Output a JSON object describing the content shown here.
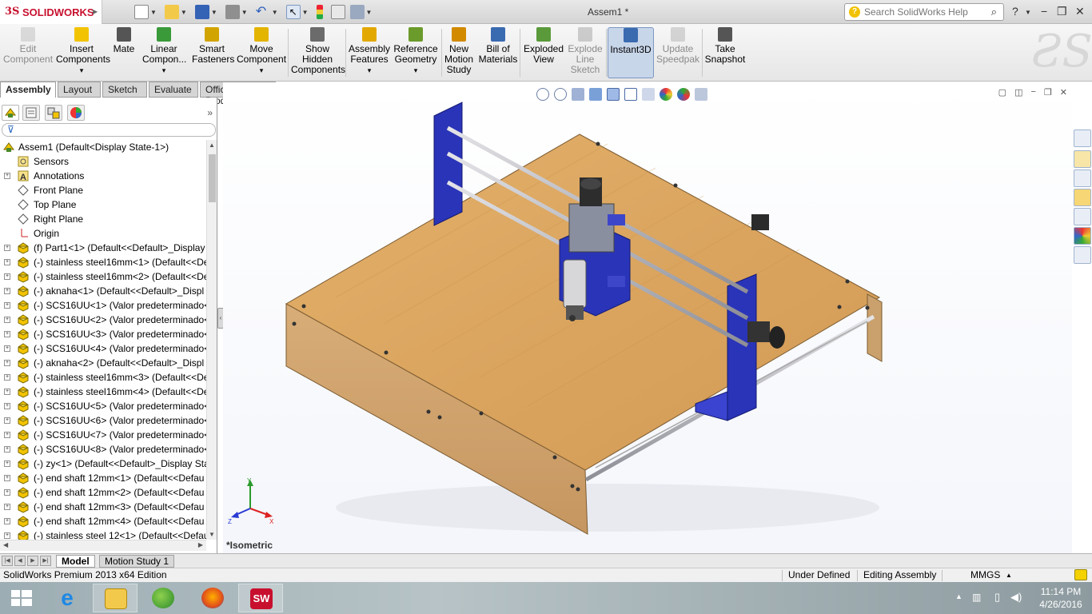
{
  "app": {
    "logo_mark": "3S",
    "logo_name": "SOLIDWORKS",
    "document_title": "Assem1 *",
    "help_search_placeholder": "Search SolidWorks Help"
  },
  "command_manager": {
    "items": [
      {
        "label": "Edit\nComponent",
        "icon": "edit-component-icon",
        "disabled": true
      },
      {
        "label": "Insert\nComponents",
        "icon": "insert-components-icon",
        "dropdown": true
      },
      {
        "label": "Mate",
        "icon": "mate-icon"
      },
      {
        "label": "Linear\nCompon...",
        "icon": "linear-pattern-icon",
        "dropdown": true
      },
      {
        "label": "Smart\nFasteners",
        "icon": "smart-fasteners-icon"
      },
      {
        "label": "Move\nComponent",
        "icon": "move-component-icon",
        "dropdown": true
      },
      {
        "label": "Show\nHidden\nComponents",
        "icon": "show-hidden-icon"
      },
      {
        "label": "Assembly\nFeatures",
        "icon": "assembly-features-icon",
        "dropdown": true
      },
      {
        "label": "Reference\nGeometry",
        "icon": "reference-geometry-icon",
        "dropdown": true
      },
      {
        "label": "New\nMotion\nStudy",
        "icon": "motion-study-icon"
      },
      {
        "label": "Bill of\nMaterials",
        "icon": "bom-icon"
      },
      {
        "label": "Exploded\nView",
        "icon": "exploded-view-icon"
      },
      {
        "label": "Explode\nLine\nSketch",
        "icon": "explode-line-icon",
        "disabled": true
      },
      {
        "label": "Instant3D",
        "icon": "instant3d-icon",
        "active": true
      },
      {
        "label": "Update\nSpeedpak",
        "icon": "speedpak-icon",
        "disabled": true
      },
      {
        "label": "Take\nSnapshot",
        "icon": "snapshot-icon"
      }
    ]
  },
  "tabs": [
    "Assembly",
    "Layout",
    "Sketch",
    "Evaluate",
    "Office Products"
  ],
  "selected_tab": "Assembly",
  "tree": {
    "root": "Assem1  (Default<Display State-1>)",
    "items": [
      {
        "label": "Sensors",
        "icon": "sensors-icon",
        "expand": false
      },
      {
        "label": "Annotations",
        "icon": "annotations-icon",
        "expand": true
      },
      {
        "label": "Front Plane",
        "icon": "plane-icon",
        "expand": false
      },
      {
        "label": "Top Plane",
        "icon": "plane-icon",
        "expand": false
      },
      {
        "label": "Right Plane",
        "icon": "plane-icon",
        "expand": false
      },
      {
        "label": "Origin",
        "icon": "origin-icon",
        "expand": false
      },
      {
        "label": "(f) Part1<1> (Default<<Default>_Display",
        "icon": "part-icon",
        "expand": true
      },
      {
        "label": "(-) stainless steel16mm<1> (Default<<De",
        "icon": "part-icon",
        "expand": true
      },
      {
        "label": "(-) stainless steel16mm<2> (Default<<De",
        "icon": "part-icon",
        "expand": true
      },
      {
        "label": "(-) aknaha<1> (Default<<Default>_Displ",
        "icon": "part-icon",
        "expand": true
      },
      {
        "label": "(-) SCS16UU<1> (Valor predeterminado<",
        "icon": "part-icon",
        "expand": true
      },
      {
        "label": "(-) SCS16UU<2> (Valor predeterminado<",
        "icon": "part-icon",
        "expand": true
      },
      {
        "label": "(-) SCS16UU<3> (Valor predeterminado<",
        "icon": "part-icon",
        "expand": true
      },
      {
        "label": "(-) SCS16UU<4> (Valor predeterminado<",
        "icon": "part-icon",
        "expand": true
      },
      {
        "label": "(-) aknaha<2> (Default<<Default>_Displ",
        "icon": "part-icon",
        "expand": true
      },
      {
        "label": "(-) stainless steel16mm<3> (Default<<De",
        "icon": "part-icon",
        "expand": true
      },
      {
        "label": "(-) stainless steel16mm<4> (Default<<De",
        "icon": "part-icon",
        "expand": true
      },
      {
        "label": "(-) SCS16UU<5> (Valor predeterminado<",
        "icon": "part-icon",
        "expand": true
      },
      {
        "label": "(-) SCS16UU<6> (Valor predeterminado<",
        "icon": "part-icon",
        "expand": true
      },
      {
        "label": "(-) SCS16UU<7> (Valor predeterminado<",
        "icon": "part-icon",
        "expand": true
      },
      {
        "label": "(-) SCS16UU<8> (Valor predeterminado<",
        "icon": "part-icon",
        "expand": true
      },
      {
        "label": "(-) zy<1> (Default<<Default>_Display Sta",
        "icon": "part-icon",
        "expand": true
      },
      {
        "label": "(-) end shaft 12mm<1> (Default<<Defau",
        "icon": "part-icon",
        "expand": true
      },
      {
        "label": "(-) end shaft 12mm<2> (Default<<Defau",
        "icon": "part-icon",
        "expand": true
      },
      {
        "label": "(-) end shaft 12mm<3> (Default<<Defau",
        "icon": "part-icon",
        "expand": true
      },
      {
        "label": "(-) end shaft 12mm<4> (Default<<Defau",
        "icon": "part-icon",
        "expand": true
      },
      {
        "label": "(-) stainless steel 12<1> (Default<<Defau",
        "icon": "part-icon",
        "expand": true
      }
    ]
  },
  "graphics": {
    "view_label": "*Isometric",
    "triad": {
      "x": "X",
      "y": "Y",
      "z": "Z"
    }
  },
  "bottom_tabs": [
    "Model",
    "Motion Study 1"
  ],
  "selected_bottom_tab": "Model",
  "status": {
    "edition": "SolidWorks Premium 2013 x64 Edition",
    "definition": "Under Defined",
    "mode": "Editing Assembly",
    "units": "MMGS",
    "units_arrow": "▲"
  },
  "taskbar": {
    "apps": [
      {
        "name": "start-button"
      },
      {
        "name": "internet-explorer-icon"
      },
      {
        "name": "file-explorer-icon",
        "open": true
      },
      {
        "name": "parrot-app-icon"
      },
      {
        "name": "firefox-icon"
      },
      {
        "name": "solidworks-taskbar-icon",
        "open": true
      }
    ],
    "time": "11:14 PM",
    "date": "4/26/2016"
  },
  "colors": {
    "accent_red": "#c8102e",
    "wood": "#d9a862",
    "plate_blue": "#2a34b8",
    "rod": "#b9b9bf"
  }
}
